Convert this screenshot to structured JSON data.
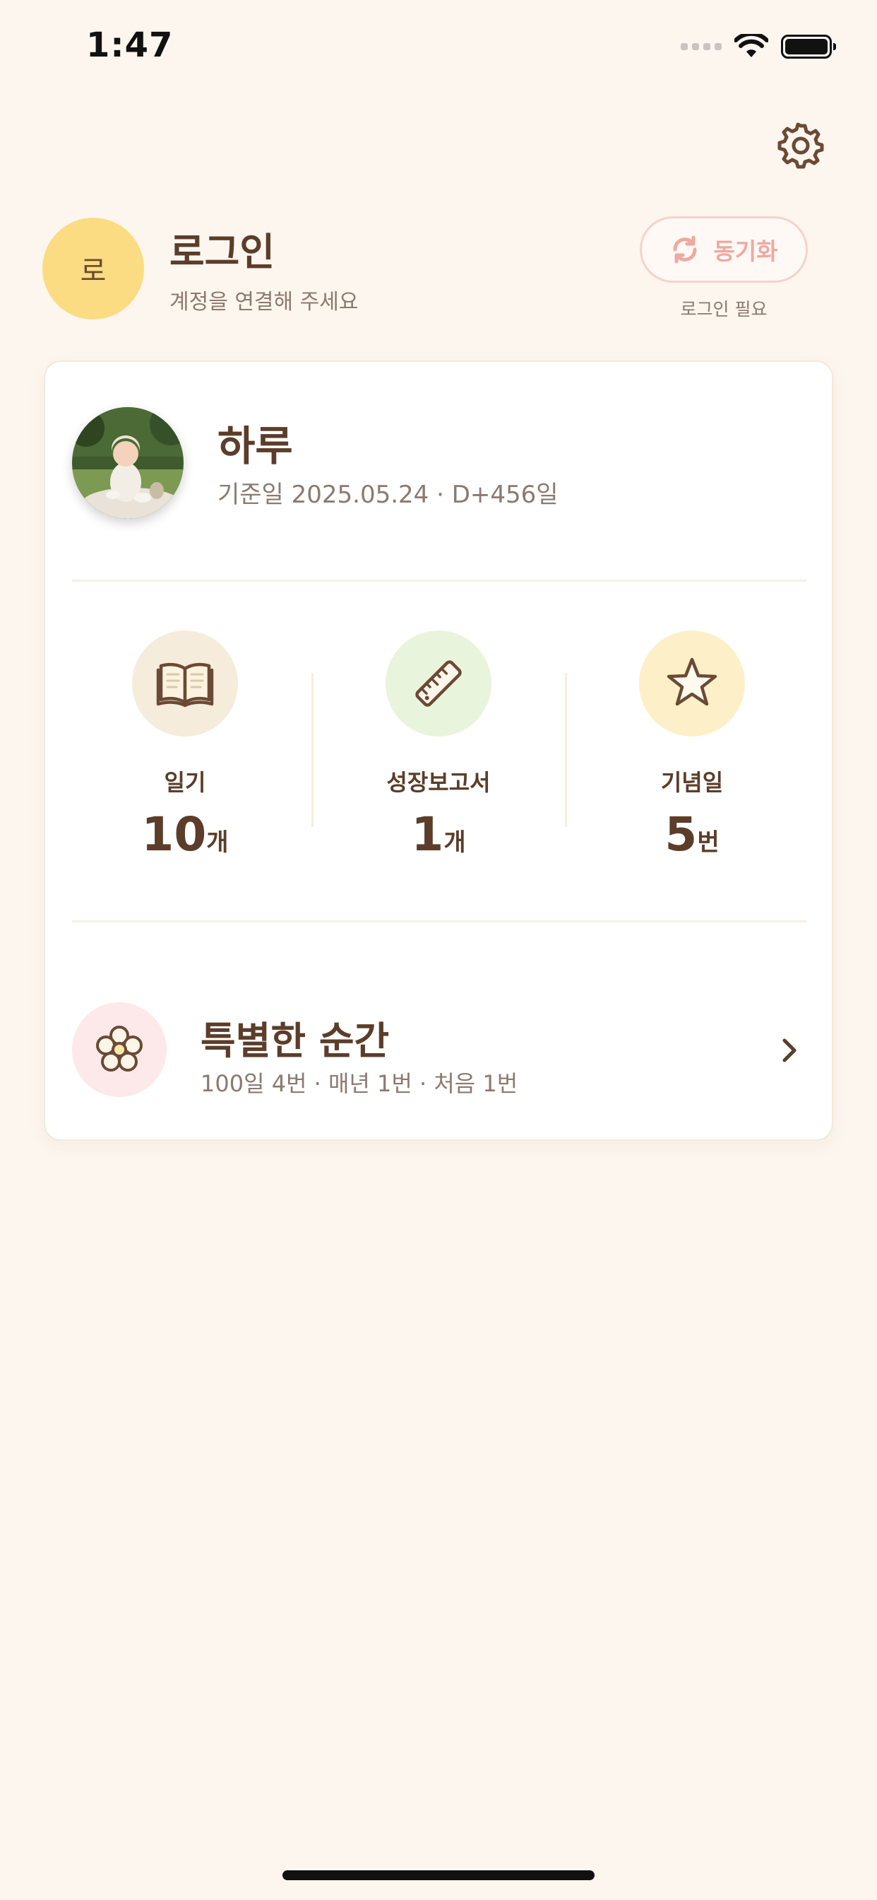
{
  "status_bar": {
    "time": "1:47"
  },
  "header": {
    "settings_icon": "gear-icon"
  },
  "profile": {
    "avatar_initial": "로",
    "title": "로그인",
    "subtitle": "계정을 연결해 주세요",
    "sync_button_label": "동기화",
    "sync_icon": "refresh-icon",
    "sync_note": "로그인 필요"
  },
  "baby": {
    "name": "하루",
    "meta": "기준일 2025.05.24 · D+456일"
  },
  "stats": [
    {
      "label": "일기",
      "value": "10",
      "unit": "개",
      "icon": "book-icon",
      "color": "#f5ecdb"
    },
    {
      "label": "성장보고서",
      "value": "1",
      "unit": "개",
      "icon": "ruler-icon",
      "color": "#e9f4dc"
    },
    {
      "label": "기념일",
      "value": "5",
      "unit": "번",
      "icon": "star-icon",
      "color": "#fdf0c8"
    }
  ],
  "special": {
    "title": "특별한 순간",
    "subtitle": "100일 4번 · 매년 1번 · 처음 1번",
    "icon": "flower-icon"
  },
  "colors": {
    "background": "#fdf6ef",
    "accent_yellow": "#fbdc82",
    "text_brown": "#5b3d2a",
    "sync_pink": "#f0a8a0"
  }
}
